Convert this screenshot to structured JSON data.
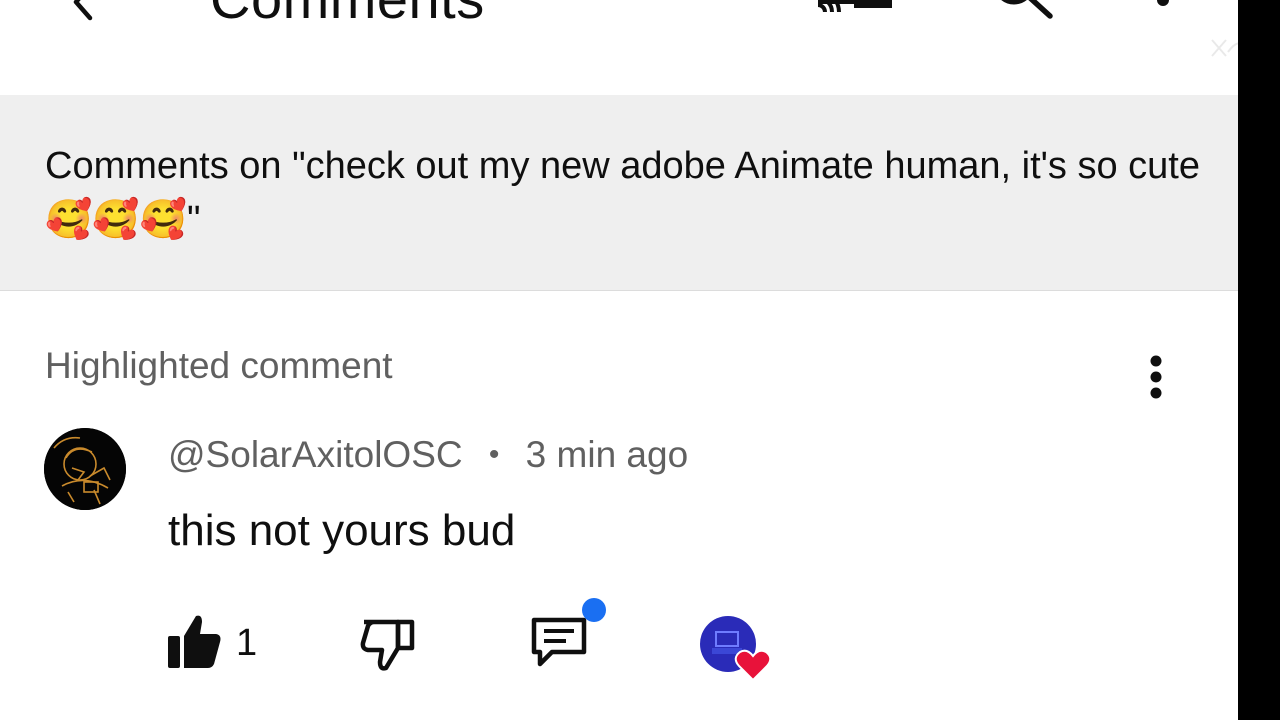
{
  "header": {
    "title": "Comments",
    "icons": [
      "back-icon",
      "cast-icon",
      "search-icon",
      "more-vert-icon"
    ]
  },
  "video": {
    "comments_on_text": "Comments on \"check out my new adobe Animate human, it's so cute🥰🥰🥰\""
  },
  "highlighted": {
    "label": "Highlighted comment"
  },
  "comment": {
    "author": "@SolarAxitolOSC",
    "separator": "•",
    "time": "3 min ago",
    "text": "this not yours bud",
    "likes": "1"
  },
  "colors": {
    "background": "#ffffff",
    "header_band": "#efefef",
    "primary_text": "#0f0f0f",
    "secondary_text": "#606060",
    "notification_dot": "#1a6ff2",
    "heart": "#e8123a",
    "creator_avatar": "#2a2bb8"
  }
}
